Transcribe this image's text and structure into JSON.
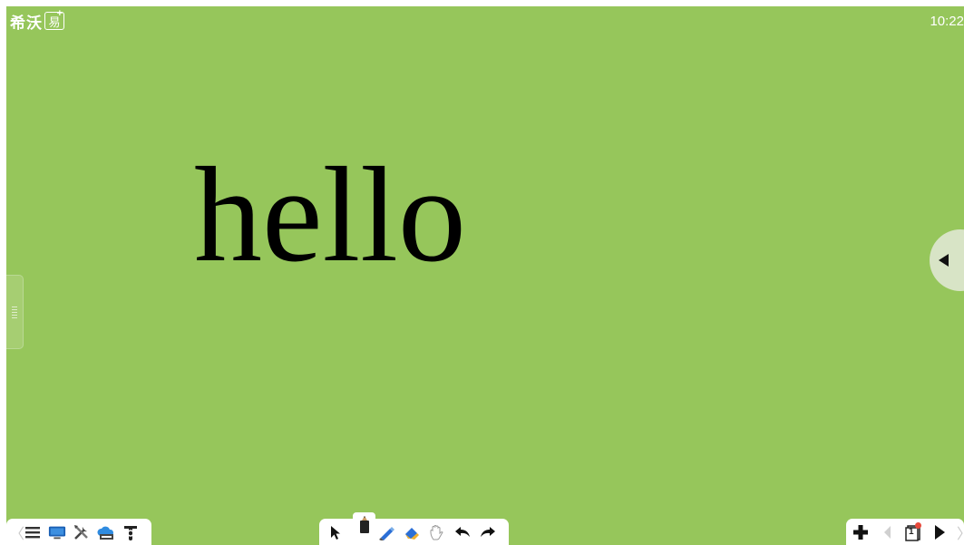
{
  "header": {
    "logo_text": "希沃",
    "logo_mark": "易",
    "logo_plus": "+",
    "clock": "10:22"
  },
  "canvas": {
    "text": "hello",
    "background_color": "#96c65b"
  },
  "toolbar_left": {
    "icons": [
      "collapse-chevron-icon",
      "menu-icon",
      "desktop-icon",
      "tools-icon",
      "cloud-upload-icon",
      "text-recognition-icon"
    ]
  },
  "toolbar_middle": {
    "icons": [
      "select-arrow-icon",
      "pen-icon",
      "highlighter-icon",
      "eraser-icon",
      "hand-icon",
      "undo-icon",
      "redo-icon"
    ],
    "active": "pen-icon"
  },
  "toolbar_right": {
    "icons": [
      "add-page-icon",
      "prev-page-icon",
      "page-counter-icon",
      "next-page-icon",
      "expand-chevron-icon"
    ],
    "page_number": "1"
  }
}
